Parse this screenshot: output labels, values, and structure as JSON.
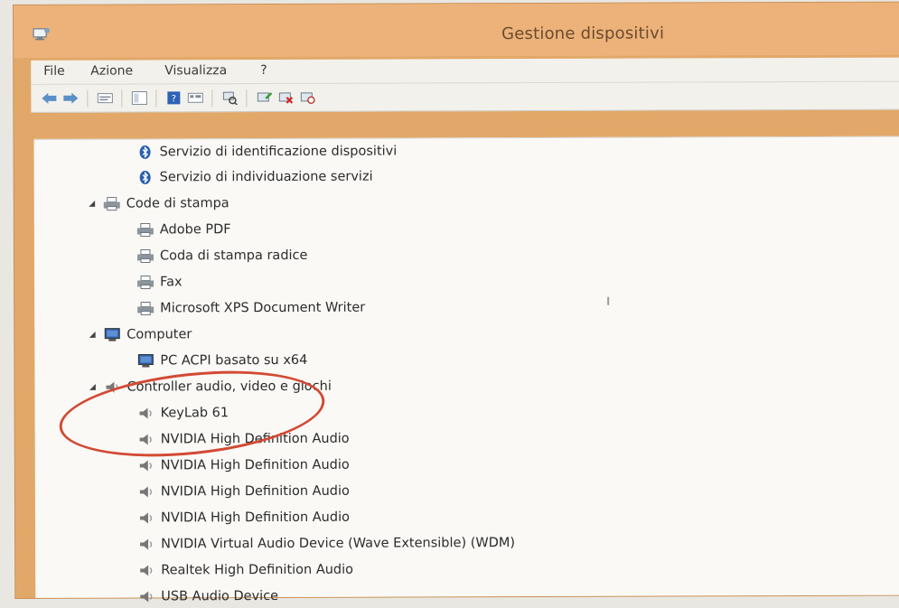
{
  "window": {
    "title": "Gestione dispositivi",
    "icon": "device-manager-icon"
  },
  "menu": [
    {
      "label": "File",
      "accel": "F"
    },
    {
      "label": "Azione",
      "accel": "A"
    },
    {
      "label": "Visualizza",
      "accel": "V"
    },
    {
      "label": "?",
      "accel": "?"
    }
  ],
  "toolbar": [
    "back-icon",
    "forward-icon",
    "properties-icon",
    "console-tree-icon",
    "help-icon",
    "view-icon",
    "scan-hardware-icon",
    "update-driver-icon",
    "uninstall-icon",
    "disable-icon"
  ],
  "tree": [
    {
      "label": "Servizio di identificazione dispositivi",
      "level": 2,
      "icon": "bluetooth-icon"
    },
    {
      "label": "Servizio di individuazione servizi",
      "level": 2,
      "icon": "bluetooth-icon"
    },
    {
      "label": "Code di stampa",
      "level": 1,
      "icon": "printer-icon",
      "expanded": true
    },
    {
      "label": "Adobe PDF",
      "level": 2,
      "icon": "printer-icon"
    },
    {
      "label": "Coda di stampa radice",
      "level": 2,
      "icon": "printer-icon"
    },
    {
      "label": "Fax",
      "level": 2,
      "icon": "printer-icon"
    },
    {
      "label": "Microsoft XPS Document Writer",
      "level": 2,
      "icon": "printer-icon"
    },
    {
      "label": "Computer",
      "level": 1,
      "icon": "computer-icon",
      "expanded": true
    },
    {
      "label": "PC ACPI basato su x64",
      "level": 2,
      "icon": "computer-icon"
    },
    {
      "label": "Controller audio, video e giochi",
      "level": 1,
      "icon": "speaker-icon",
      "expanded": true
    },
    {
      "label": "KeyLab 61",
      "level": 2,
      "icon": "speaker-icon"
    },
    {
      "label": "NVIDIA High Definition Audio",
      "level": 2,
      "icon": "speaker-icon"
    },
    {
      "label": "NVIDIA High Definition Audio",
      "level": 2,
      "icon": "speaker-icon"
    },
    {
      "label": "NVIDIA High Definition Audio",
      "level": 2,
      "icon": "speaker-icon"
    },
    {
      "label": "NVIDIA High Definition Audio",
      "level": 2,
      "icon": "speaker-icon"
    },
    {
      "label": "NVIDIA Virtual Audio Device (Wave Extensible) (WDM)",
      "level": 2,
      "icon": "speaker-icon"
    },
    {
      "label": "Realtek High Definition Audio",
      "level": 2,
      "icon": "speaker-icon"
    },
    {
      "label": "USB Audio Device",
      "level": 2,
      "icon": "speaker-icon"
    }
  ],
  "colors": {
    "titlebar": "#ecb27a",
    "highlight_ring": "#d24a34"
  }
}
